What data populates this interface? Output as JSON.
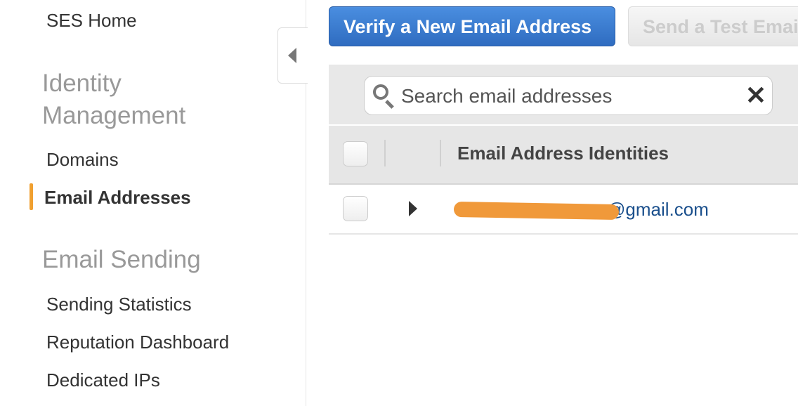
{
  "sidebar": {
    "home": "SES Home",
    "sections": [
      {
        "title": "Identity Management",
        "items": [
          "Domains",
          "Email Addresses"
        ]
      },
      {
        "title": "Email Sending",
        "items": [
          "Sending Statistics",
          "Reputation Dashboard",
          "Dedicated IPs"
        ]
      }
    ],
    "active_item": "Email Addresses",
    "accent_color": "#f0a030"
  },
  "toolbar": {
    "verify_label": "Verify a New Email Address",
    "test_label": "Send a Test Email"
  },
  "search": {
    "placeholder": "Search email addresses"
  },
  "table": {
    "column_header": "Email Address Identities",
    "rows": [
      {
        "email_visible": "@gmail.com",
        "redacted": true
      }
    ]
  }
}
